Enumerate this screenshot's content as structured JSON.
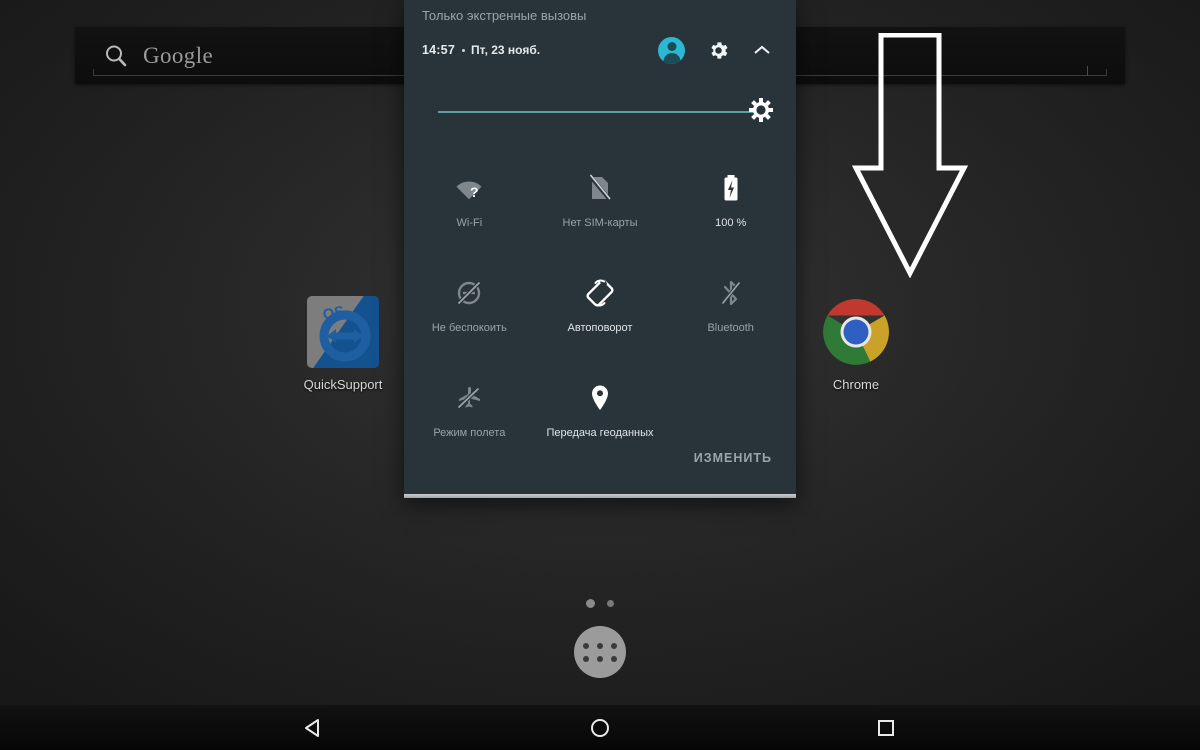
{
  "home": {
    "search": {
      "label": "Google",
      "icon": "search-icon"
    },
    "apps": [
      {
        "name": "QuickSupport",
        "label": "QuickSupport",
        "icon": "quicksupport-icon",
        "badge": "QS"
      },
      {
        "name": "Chrome",
        "label": "Chrome",
        "icon": "chrome-icon"
      }
    ],
    "page_indicator": {
      "pages": 2,
      "active": 1
    },
    "drawer_button": {
      "name": "app-drawer-button"
    }
  },
  "quick_settings": {
    "emergency_text": "Только экстренные вызовы",
    "time": "14:57",
    "date": "Пт, 23 нояб.",
    "header_actions": {
      "avatar": "user-avatar",
      "settings": "gear-icon",
      "collapse": "chevron-up-icon"
    },
    "brightness": {
      "icon": "brightness-icon",
      "value": 100
    },
    "tiles": [
      [
        {
          "label": "Wi-Fi",
          "icon": "wifi-question-icon",
          "state": "off"
        },
        {
          "label": "Нет SIM-карты",
          "icon": "sim-none-icon",
          "state": "off"
        },
        {
          "label": "100 %",
          "icon": "battery-charging-icon",
          "state": "on"
        }
      ],
      [
        {
          "label": "Не беспокоить",
          "icon": "do-not-disturb-icon",
          "state": "off"
        },
        {
          "label": "Автоповорот",
          "icon": "auto-rotate-icon",
          "state": "on"
        },
        {
          "label": "Bluetooth",
          "icon": "bluetooth-icon",
          "state": "off"
        }
      ],
      [
        {
          "label": "Режим полета",
          "icon": "airplane-mode-icon",
          "state": "off"
        },
        {
          "label": "Передача геоданных",
          "icon": "location-icon",
          "state": "on"
        },
        {
          "label": "",
          "icon": "",
          "state": "empty"
        }
      ]
    ],
    "edit_label": "ИЗМЕНИТЬ"
  },
  "annotation": {
    "arrow": "down-arrow-annotation"
  },
  "navbar": {
    "back": "back-triangle-icon",
    "home": "home-circle-icon",
    "recents": "recents-square-icon"
  },
  "colors": {
    "panel_bg": "#28343a",
    "wallpaper": "#262626",
    "accent": "#2ab8d4",
    "slider": "#5f9ea0",
    "label": "#dfe4e7",
    "label_dim": "#99a3a8"
  }
}
